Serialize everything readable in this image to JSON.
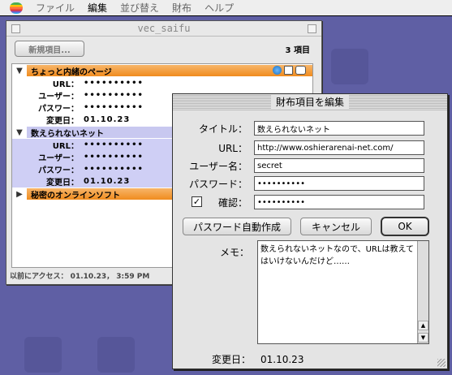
{
  "menubar": {
    "items": [
      {
        "label": "ファイル",
        "bold": false
      },
      {
        "label": "編集",
        "bold": true
      },
      {
        "label": "並び替え",
        "bold": false
      },
      {
        "label": "財布",
        "bold": false
      },
      {
        "label": "ヘルプ",
        "bold": false
      }
    ]
  },
  "main_window": {
    "title": "vec_saifu",
    "new_item_button": "新規項目...",
    "item_count": "3 項目",
    "groups": [
      {
        "name": "ちょっと内緒のページ",
        "expanded": true,
        "fields": [
          {
            "key": "URL：",
            "value": "••••••••••"
          },
          {
            "key": "ユーザー：",
            "value": "••••••••••"
          },
          {
            "key": "パスワー：",
            "value": "••••••••••"
          },
          {
            "key": "変更日：",
            "value": "01.10.23"
          }
        ]
      },
      {
        "name": "数えられないネット",
        "expanded": true,
        "fields": [
          {
            "key": "URL：",
            "value": "••••••••••"
          },
          {
            "key": "ユーザー：",
            "value": "••••••••••"
          },
          {
            "key": "パスワー：",
            "value": "••••••••••"
          },
          {
            "key": "変更日：",
            "value": "01.10.23"
          }
        ]
      },
      {
        "name": "秘密のオンラインソフト",
        "expanded": false,
        "fields": []
      }
    ],
    "status": "以前にアクセス： 01.10.23， 3:59 PM"
  },
  "dialog": {
    "title": "財布項目を編集",
    "fields": {
      "title_label": "タイトル：",
      "title_value": "数えられないネット",
      "url_label": "URL：",
      "url_value": "http://www.oshierarenai-net.com/",
      "user_label": "ユーザー名：",
      "user_value": "secret",
      "password_label": "パスワード：",
      "password_value": "••••••••••",
      "confirm_label": "確認：",
      "confirm_value": "••••••••••",
      "confirm_checked": true
    },
    "buttons": {
      "generate": "パスワード自動作成",
      "cancel": "キャンセル",
      "ok": "OK"
    },
    "memo_label": "メモ：",
    "memo_text": "数えられないネットなので、URLは教えてはいけないんだけど……",
    "modified_label": "変更日：",
    "modified_value": "01.10.23"
  }
}
